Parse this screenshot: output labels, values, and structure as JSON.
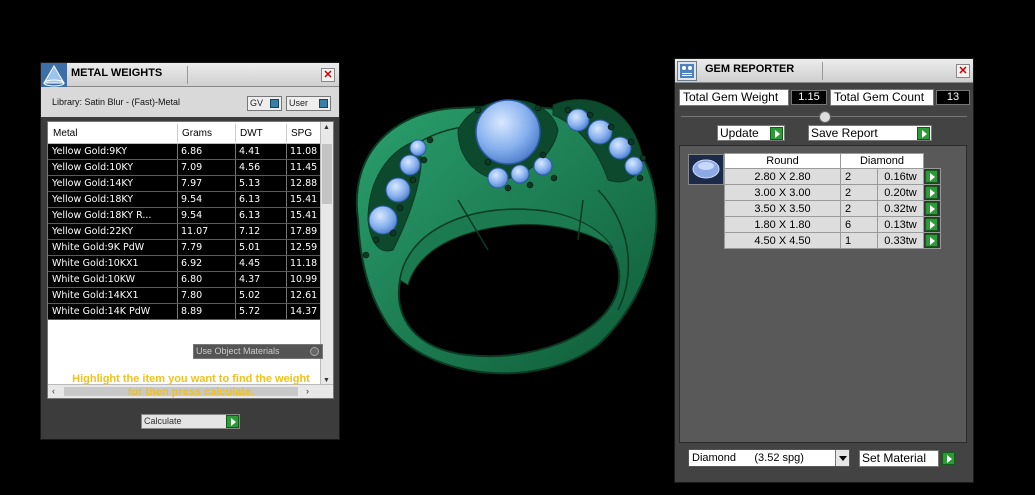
{
  "metal_weights": {
    "title": "METAL WEIGHTS",
    "library_label": "Library: Satin Blur - (Fast)-Metal",
    "toggle_gv": "GV",
    "toggle_user": "User",
    "columns": [
      "Metal",
      "Grams",
      "DWT",
      "SPG"
    ],
    "rows": [
      {
        "metal": "Yellow Gold:9KY",
        "grams": "6.86",
        "dwt": "4.41",
        "spg": "11.08"
      },
      {
        "metal": "Yellow Gold:10KY",
        "grams": "7.09",
        "dwt": "4.56",
        "spg": "11.45"
      },
      {
        "metal": "Yellow Gold:14KY",
        "grams": "7.97",
        "dwt": "5.13",
        "spg": "12.88"
      },
      {
        "metal": "Yellow Gold:18KY",
        "grams": "9.54",
        "dwt": "6.13",
        "spg": "15.41"
      },
      {
        "metal": "Yellow Gold:18KY R...",
        "grams": "9.54",
        "dwt": "6.13",
        "spg": "15.41"
      },
      {
        "metal": "Yellow Gold:22KY",
        "grams": "11.07",
        "dwt": "7.12",
        "spg": "17.89"
      },
      {
        "metal": "White Gold:9K PdW",
        "grams": "7.79",
        "dwt": "5.01",
        "spg": "12.59"
      },
      {
        "metal": "White Gold:10KX1",
        "grams": "6.92",
        "dwt": "4.45",
        "spg": "11.18"
      },
      {
        "metal": "White Gold:10KW",
        "grams": "6.80",
        "dwt": "4.37",
        "spg": "10.99"
      },
      {
        "metal": "White Gold:14KX1",
        "grams": "7.80",
        "dwt": "5.02",
        "spg": "12.61"
      },
      {
        "metal": "White Gold:14K PdW",
        "grams": "8.89",
        "dwt": "5.72",
        "spg": "14.37"
      }
    ],
    "use_object_materials": "Use Object Materials",
    "hint_line1": "Highlight the item you want to find the weight",
    "hint_line2": "for then press calculate.",
    "calculate_value": "Calculate"
  },
  "gem_reporter": {
    "title": "GEM REPORTER",
    "total_weight_label": "Total Gem Weight",
    "total_weight_value": "1.15",
    "total_count_label": "Total Gem Count",
    "total_count_value": "13",
    "update_label": "Update",
    "save_report_label": "Save Report",
    "table_header_shape": "Round",
    "table_header_material": "Diamond",
    "gems": [
      {
        "size": "2.80 X 2.80",
        "count": "2",
        "weight": "0.16tw"
      },
      {
        "size": "3.00 X 3.00",
        "count": "2",
        "weight": "0.20tw"
      },
      {
        "size": "3.50 X 3.50",
        "count": "2",
        "weight": "0.32tw"
      },
      {
        "size": "1.80 X 1.80",
        "count": "6",
        "weight": "0.13tw"
      },
      {
        "size": "4.50 X 4.50",
        "count": "1",
        "weight": "0.33tw"
      }
    ],
    "material_select": "Diamond      (3.52 spg)",
    "set_material_label": "Set Material"
  },
  "colors": {
    "ring_metal": "#1f8a5c",
    "gem_blue": "#8fb8f0",
    "hint_yellow": "#f1c21b",
    "button_green": "#2e9a37"
  }
}
